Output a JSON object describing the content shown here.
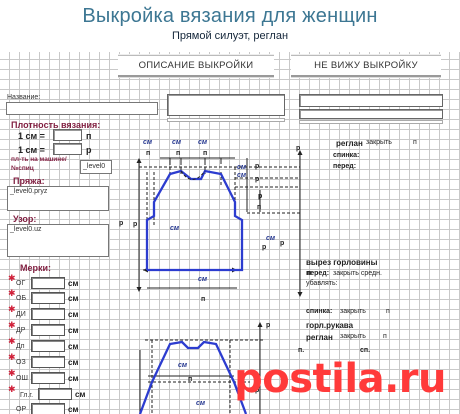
{
  "header": {
    "title": "Выкройка вязания для женщин",
    "subtitle": "Прямой силуэт, реглан"
  },
  "nav": {
    "description_button": "ОПИСАНИЕ ВЫКРОЙКИ",
    "cant_see_button": "НЕ ВИЖУ ВЫКРОЙКУ"
  },
  "form": {
    "name_label": "Название:",
    "density_title": "Плотность вязания:",
    "density_row1_prefix": "1 см =",
    "density_row1_suffix": "п",
    "density_row2_prefix": "1 см =",
    "density_row2_suffix": "р",
    "machine_label": "пл-ть на машине/",
    "needles_label": "№спиц",
    "needles_value": "_level0",
    "yarn_title": "Пряжа:",
    "yarn_value": "_level0.pryz",
    "pattern_title": "Узор:",
    "pattern_value": "_level0.uz",
    "measures_title": "Мерки:",
    "measures": [
      {
        "code": "ОГ",
        "unit": "см"
      },
      {
        "code": "ОБ",
        "unit": "см"
      },
      {
        "code": "ДИ",
        "unit": "см"
      },
      {
        "code": "ДР",
        "unit": "см"
      },
      {
        "code": "Дп",
        "unit": "см"
      },
      {
        "code": "ОЗ",
        "unit": "см"
      },
      {
        "code": "ОШ",
        "unit": "см"
      },
      {
        "code": "Гл.г.",
        "unit": "см"
      },
      {
        "code": "ОР",
        "unit": "см"
      }
    ]
  },
  "diagram": {
    "unit_cm": "см",
    "unit_p": "п",
    "unit_r": "р",
    "raglan_label": "реглан",
    "close_label": "закрыть",
    "back_label": "спинка:",
    "front_label": "перед:",
    "neckline_title": "вырез горловины",
    "neck_front_label": "перед:",
    "neck_front_text": "закрыть средн.",
    "neck_decrease": "убавлять:",
    "neck_back_label": "спинка:",
    "neck_back_text": "закрыть",
    "sleeve_neck_title": "горл.рукава",
    "sleeve_raglan_title": "реглан",
    "sleeve_raglan_text": "закрыть",
    "sleeve_p": "п.",
    "sleeve_sp": "сп."
  },
  "watermark": {
    "text_main": "postila",
    "text_dot": ".ru"
  }
}
